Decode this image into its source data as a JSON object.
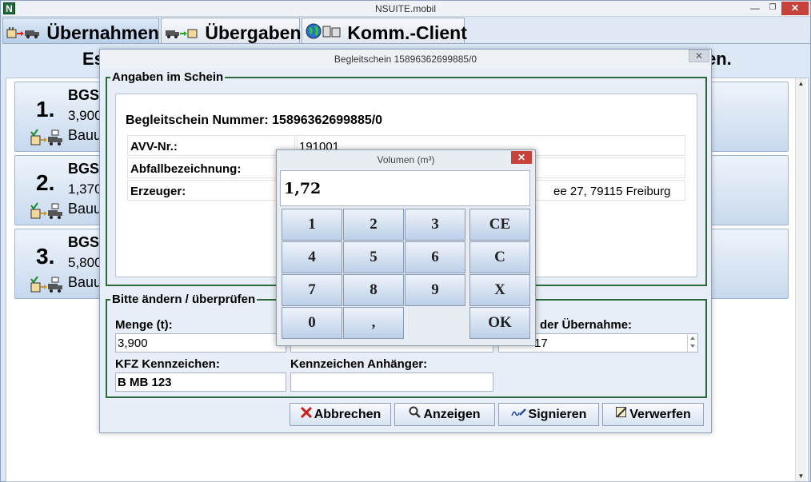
{
  "window": {
    "title": "NSUITE.mobil",
    "app_icon_letter": "N",
    "min": "—",
    "max": "❐",
    "close": "✕"
  },
  "tabs": [
    {
      "label": "Übernahmen"
    },
    {
      "label": "Übergaben"
    },
    {
      "label": "Komm.-Client"
    }
  ],
  "heading": {
    "left": "Es",
    "right": "en."
  },
  "cards": [
    {
      "number": "1.",
      "code": "BGS",
      "quantity": "3,900",
      "description": "Bauu"
    },
    {
      "number": "2.",
      "code": "BGS",
      "quantity": "1,370",
      "description": "Bauu"
    },
    {
      "number": "3.",
      "code": "BGS",
      "quantity": "5,800",
      "description": "Bauu"
    }
  ],
  "dialog": {
    "title": "Begleitschein 15896362699885/0",
    "close": "✕",
    "group1_legend": "Angaben im Schein",
    "bs_number": "Begleitschein Nummer: 15896362699885/0",
    "rows": [
      {
        "label": "AVV-Nr.:",
        "value": "191001"
      },
      {
        "label": "Abfallbezeichnung:",
        "value": ""
      },
      {
        "label": "Erzeuger:",
        "value": "ee 27, 79115 Freiburg"
      }
    ],
    "group2_legend": "Bitte ändern / überprüfen",
    "menge_label": "Menge (t):",
    "menge_value": "3,900",
    "uebernahme_label": "der Übernahme:",
    "uebernahme_value": "17",
    "kfz_label": "KFZ Kennzeichen:",
    "kfz_value": "B MB 123",
    "anhaenger_label": "Kennzeichen Anhänger:",
    "anhaenger_value": "",
    "buttons": {
      "abbrechen": "Abbrechen",
      "anzeigen": "Anzeigen",
      "signieren": "Signieren",
      "verwerfen": "Verwerfen"
    }
  },
  "volumen": {
    "title": "Volumen (m³)",
    "close": "✕",
    "display": "1,72",
    "keys": {
      "k1": "1",
      "k2": "2",
      "k3": "3",
      "ce": "CE",
      "k4": "4",
      "k5": "5",
      "k6": "6",
      "c": "C",
      "k7": "7",
      "k8": "8",
      "k9": "9",
      "x": "X",
      "k0": "0",
      "comma": ",",
      "ok": "OK"
    }
  },
  "colors": {
    "group_border": "#2c6a3a",
    "close_red": "#c7423a",
    "tab_active": "#b9cfe9"
  }
}
